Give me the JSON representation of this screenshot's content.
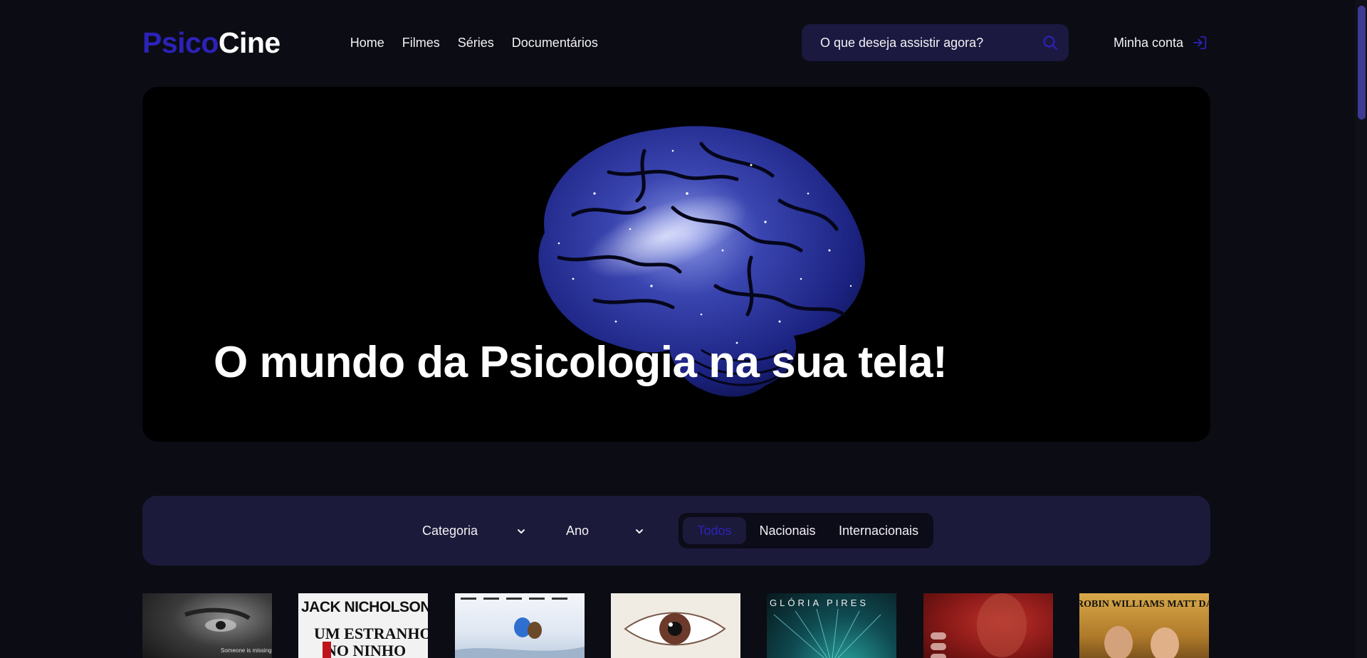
{
  "brand": {
    "part1": "Psico",
    "part2": "Cine"
  },
  "nav": [
    "Home",
    "Filmes",
    "Séries",
    "Documentários"
  ],
  "search": {
    "placeholder": "O que deseja assistir agora?"
  },
  "account": {
    "label": "Minha conta"
  },
  "hero": {
    "title": "O mundo da Psicologia na sua tela!"
  },
  "filters": {
    "category": "Categoria",
    "year": "Ano",
    "origin_options": [
      "Todos",
      "Nacionais",
      "Internacionais"
    ],
    "origin_selected": "Todos"
  },
  "posters": [
    {
      "caption": "Someone is missing."
    },
    {
      "actor": "JACK NICHOLSON",
      "title_line1": "UM ESTRANHO",
      "title_line2": "NO NINHO"
    },
    {
      "caption": ""
    },
    {
      "caption": ""
    },
    {
      "actor": "GLÓRIA PIRES"
    },
    {
      "caption": ""
    },
    {
      "actor": "ROBIN WILLIAMS   MATT DAMON"
    }
  ],
  "colors": {
    "accent": "#2c22b8",
    "background": "#0c0c14",
    "panel": "#1c1a3a",
    "search_bg": "#1b1940"
  }
}
